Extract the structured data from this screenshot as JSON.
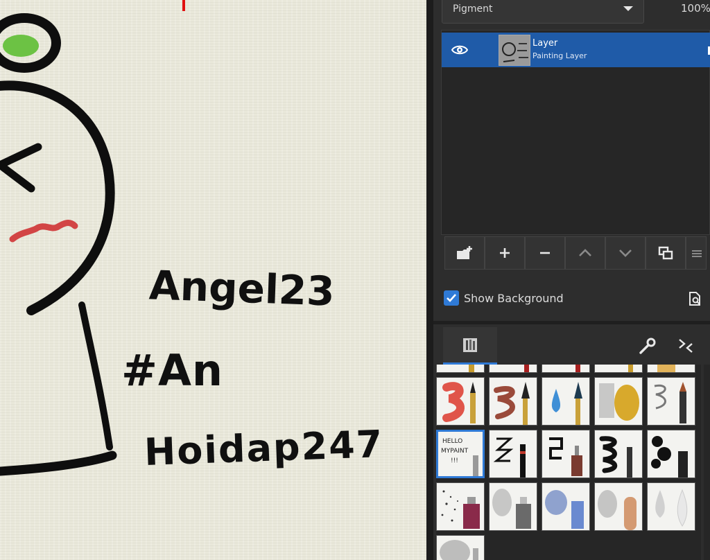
{
  "canvas": {
    "handwriting": [
      "Angel23",
      "#An",
      "Hoidap247"
    ]
  },
  "layers_panel": {
    "blend_mode": "Pigment",
    "opacity": "100%",
    "layer": {
      "name": "Layer",
      "type": "Painting Layer"
    },
    "show_background_label": "Show Background"
  },
  "brush_panel": {
    "thumbnail_texts": {
      "hello_mypaint": "HELLO MYPAINT !!!"
    }
  },
  "colors": {
    "accent": "#2f7ad6",
    "layer_selected": "#1f5ba8",
    "canvas_paper": "#e9e8da"
  }
}
